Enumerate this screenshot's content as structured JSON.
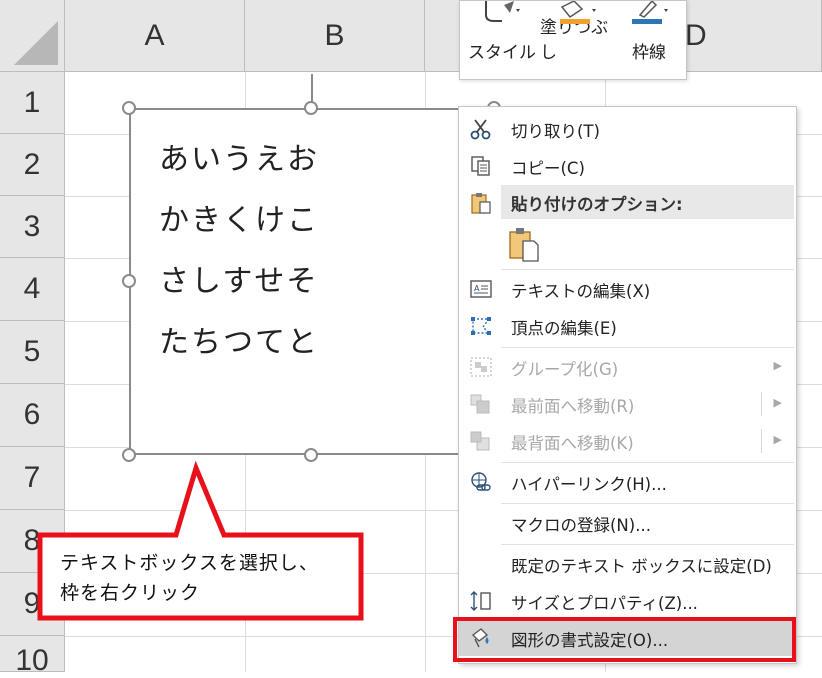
{
  "sheet": {
    "columns": [
      "A",
      "B",
      "D"
    ],
    "rows": [
      "1",
      "2",
      "3",
      "4",
      "5",
      "6",
      "7",
      "8",
      "9",
      "10"
    ]
  },
  "textbox": {
    "lines": [
      "あいうえお",
      "かきくけこ",
      "さしすせそ",
      "たちつてと"
    ]
  },
  "callout": {
    "line1": "テキストボックスを選択し、",
    "line2": "枠を右クリック",
    "border_color": "#e8101a"
  },
  "mini_toolbar": {
    "style_label": "スタイル",
    "fill_label": "塗りつぶし",
    "outline_label": "枠線"
  },
  "context_menu": {
    "cut": "切り取り(T)",
    "copy": "コピー(C)",
    "paste_options": "貼り付けのオプション:",
    "edit_text": "テキストの編集(X)",
    "edit_points": "頂点の編集(E)",
    "group": "グループ化(G)",
    "bring_front": "最前面へ移動(R)",
    "send_back": "最背面へ移動(K)",
    "hyperlink": "ハイパーリンク(H)...",
    "assign_macro": "マクロの登録(N)...",
    "set_default": "既定のテキスト ボックスに設定(D)",
    "size_props": "サイズとプロパティ(Z)...",
    "format_shape": "図形の書式設定(O)..."
  },
  "colors": {
    "highlight_red": "#e8101a",
    "fill_orange": "#f0a030",
    "outline_blue": "#2e75b6"
  }
}
